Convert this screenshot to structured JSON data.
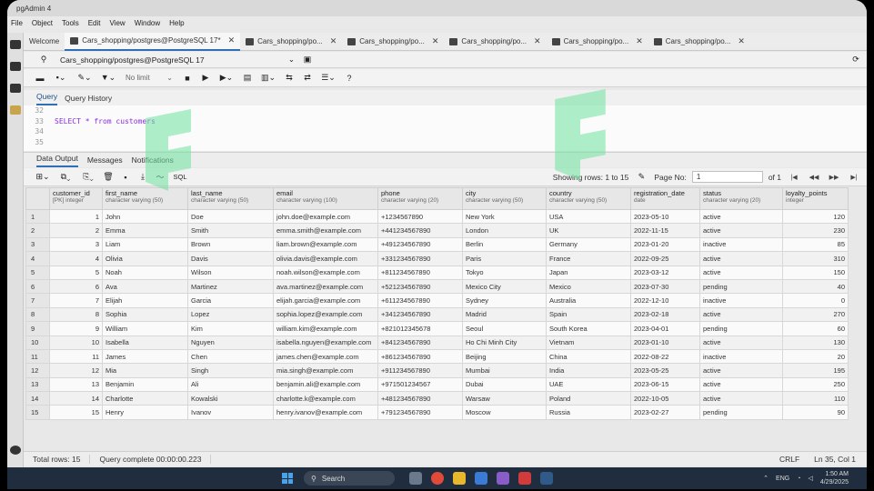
{
  "window": {
    "title": "pgAdmin 4"
  },
  "menu": [
    "File",
    "Object",
    "Tools",
    "Edit",
    "View",
    "Window",
    "Help"
  ],
  "tabs": [
    {
      "label": "Welcome"
    },
    {
      "label": "Cars_shopping/postgres@PostgreSQL 17*"
    },
    {
      "label": "Cars_shopping/po..."
    },
    {
      "label": "Cars_shopping/po..."
    },
    {
      "label": "Cars_shopping/po..."
    },
    {
      "label": "Cars_shopping/po..."
    },
    {
      "label": "Cars_shopping/po..."
    }
  ],
  "connection": {
    "value": "Cars_shopping/postgres@PostgreSQL 17"
  },
  "toolbar": {
    "limit": "No limit"
  },
  "query_tabs": [
    "Query",
    "Query History"
  ],
  "editor": {
    "lines": [
      {
        "num": "32",
        "code": ""
      },
      {
        "num": "33",
        "code": "SELECT * from customers"
      },
      {
        "num": "34",
        "code": ""
      },
      {
        "num": "35",
        "code": ""
      }
    ]
  },
  "output_tabs": [
    "Data Output",
    "Messages",
    "Notifications"
  ],
  "results": {
    "showing": "Showing rows: 1 to 15",
    "page_label": "Page No:",
    "page_value": "1",
    "of_label": "of 1",
    "sql_button": "SQL",
    "columns": [
      {
        "name": "customer_id",
        "type": "[PK] integer"
      },
      {
        "name": "first_name",
        "type": "character varying (50)"
      },
      {
        "name": "last_name",
        "type": "character varying (50)"
      },
      {
        "name": "email",
        "type": "character varying (100)"
      },
      {
        "name": "phone",
        "type": "character varying (20)"
      },
      {
        "name": "city",
        "type": "character varying (50)"
      },
      {
        "name": "country",
        "type": "character varying (50)"
      },
      {
        "name": "registration_date",
        "type": "date"
      },
      {
        "name": "status",
        "type": "character varying (20)"
      },
      {
        "name": "loyalty_points",
        "type": "integer"
      }
    ],
    "rows": [
      [
        "1",
        "John",
        "Doe",
        "john.doe@example.com",
        "+1234567890",
        "New York",
        "USA",
        "2023-05-10",
        "active",
        "120"
      ],
      [
        "2",
        "Emma",
        "Smith",
        "emma.smith@example.com",
        "+441234567890",
        "London",
        "UK",
        "2022-11-15",
        "active",
        "230"
      ],
      [
        "3",
        "Liam",
        "Brown",
        "liam.brown@example.com",
        "+491234567890",
        "Berlin",
        "Germany",
        "2023-01-20",
        "inactive",
        "85"
      ],
      [
        "4",
        "Olivia",
        "Davis",
        "olivia.davis@example.com",
        "+331234567890",
        "Paris",
        "France",
        "2022-09-25",
        "active",
        "310"
      ],
      [
        "5",
        "Noah",
        "Wilson",
        "noah.wilson@example.com",
        "+811234567890",
        "Tokyo",
        "Japan",
        "2023-03-12",
        "active",
        "150"
      ],
      [
        "6",
        "Ava",
        "Martinez",
        "ava.martinez@example.com",
        "+521234567890",
        "Mexico City",
        "Mexico",
        "2023-07-30",
        "pending",
        "40"
      ],
      [
        "7",
        "Elijah",
        "Garcia",
        "elijah.garcia@example.com",
        "+611234567890",
        "Sydney",
        "Australia",
        "2022-12-10",
        "inactive",
        "0"
      ],
      [
        "8",
        "Sophia",
        "Lopez",
        "sophia.lopez@example.com",
        "+341234567890",
        "Madrid",
        "Spain",
        "2023-02-18",
        "active",
        "270"
      ],
      [
        "9",
        "William",
        "Kim",
        "william.kim@example.com",
        "+821012345678",
        "Seoul",
        "South Korea",
        "2023-04-01",
        "pending",
        "60"
      ],
      [
        "10",
        "Isabella",
        "Nguyen",
        "isabella.nguyen@example.com",
        "+841234567890",
        "Ho Chi Minh City",
        "Vietnam",
        "2023-01-10",
        "active",
        "130"
      ],
      [
        "11",
        "James",
        "Chen",
        "james.chen@example.com",
        "+861234567890",
        "Beijing",
        "China",
        "2022-08-22",
        "inactive",
        "20"
      ],
      [
        "12",
        "Mia",
        "Singh",
        "mia.singh@example.com",
        "+911234567890",
        "Mumbai",
        "India",
        "2023-05-25",
        "active",
        "195"
      ],
      [
        "13",
        "Benjamin",
        "Ali",
        "benjamin.ali@example.com",
        "+971501234567",
        "Dubai",
        "UAE",
        "2023-06-15",
        "active",
        "250"
      ],
      [
        "14",
        "Charlotte",
        "Kowalski",
        "charlotte.k@example.com",
        "+481234567890",
        "Warsaw",
        "Poland",
        "2022-10-05",
        "active",
        "110"
      ],
      [
        "15",
        "Henry",
        "Ivanov",
        "henry.ivanov@example.com",
        "+791234567890",
        "Moscow",
        "Russia",
        "2023-02-27",
        "pending",
        "90"
      ]
    ]
  },
  "status": {
    "total_rows": "Total rows: 15",
    "query_complete": "Query complete 00:00:00.223",
    "line_ending": "CRLF",
    "position": "Ln 35, Col 1"
  },
  "taskbar": {
    "search_placeholder": "Search",
    "lang": "ENG",
    "time": "1:50 AM",
    "date": "4/29/2025"
  }
}
